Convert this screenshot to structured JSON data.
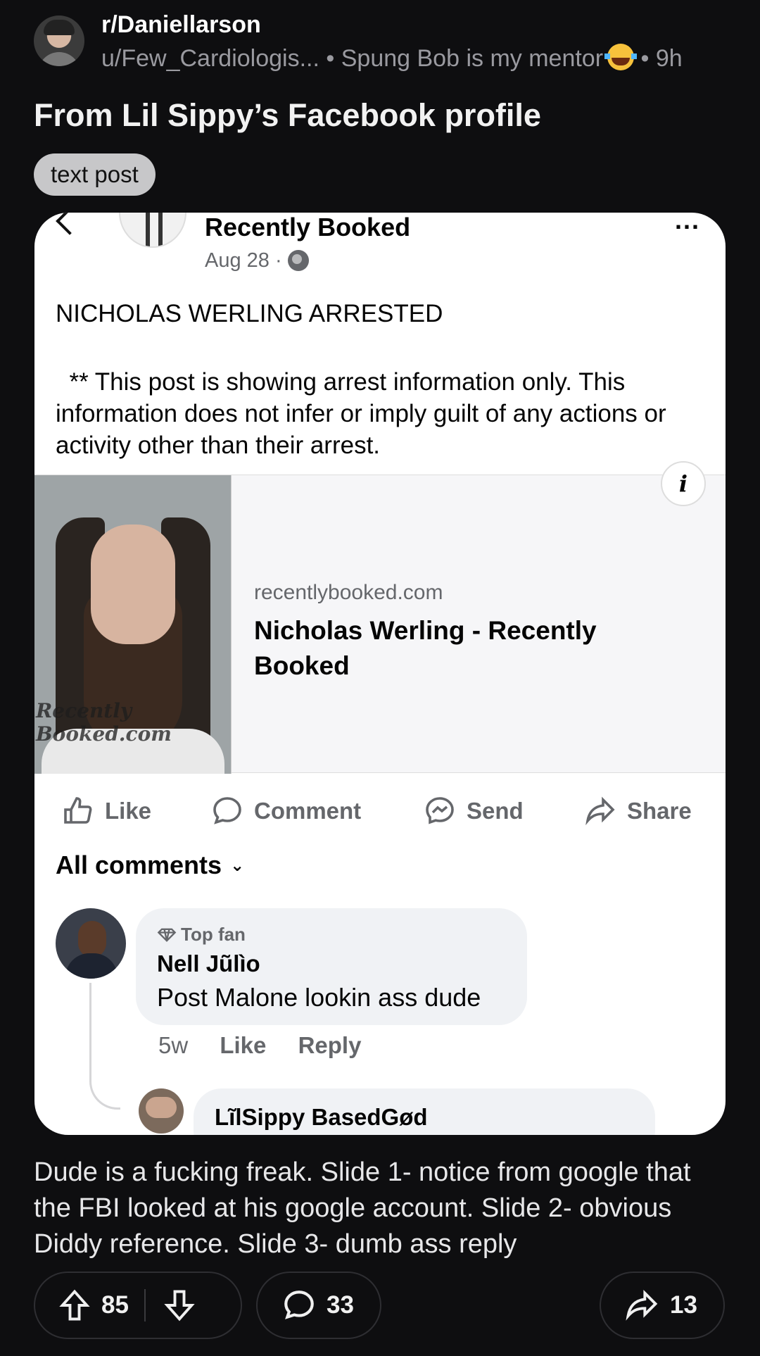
{
  "header": {
    "subreddit": "r/Daniellarson",
    "author": "u/Few_Cardiologis...",
    "flair_user": "Spung Bob is my mentor",
    "separator": "•",
    "time": "9h"
  },
  "post": {
    "title": "From Lil Sippy’s Facebook profile",
    "flair": "text post",
    "body": "Dude is a fucking freak. Slide 1- notice from google that the FBI looked at his google account. Slide 2- obvious Diddy reference. Slide 3- dumb ass reply"
  },
  "screenshot": {
    "page_name": "Recently Booked",
    "dots": "...",
    "date": "Aug 28 ·",
    "headline": "NICHOLAS WERLING ARRESTED",
    "disclaimer": "  ** This post is showing arrest information only. This information does not infer or imply guilt of any actions or activity other than their arrest.",
    "link": {
      "domain": "recentlybooked.com",
      "title": "Nicholas Werling - Recently Booked",
      "watermark": "Recently Booked.com",
      "info_icon": "i"
    },
    "actions": {
      "like": "Like",
      "comment": "Comment",
      "send": "Send",
      "share": "Share"
    },
    "comments_header": "All comments",
    "comment": {
      "badge": "Top fan",
      "name": "Nell Jũlìo",
      "text": "Post Malone lookin ass dude",
      "time": "5w",
      "like": "Like",
      "reply": "Reply"
    },
    "reply": {
      "name": "LĩlSippy BasedGød"
    }
  },
  "footer": {
    "upvotes": "85",
    "comments": "33",
    "shares": "13"
  },
  "colors": {
    "background": "#0e0e10",
    "flair_bg": "#c7c7c9",
    "card_bg": "#ffffff",
    "fb_gray": "#65676b"
  }
}
